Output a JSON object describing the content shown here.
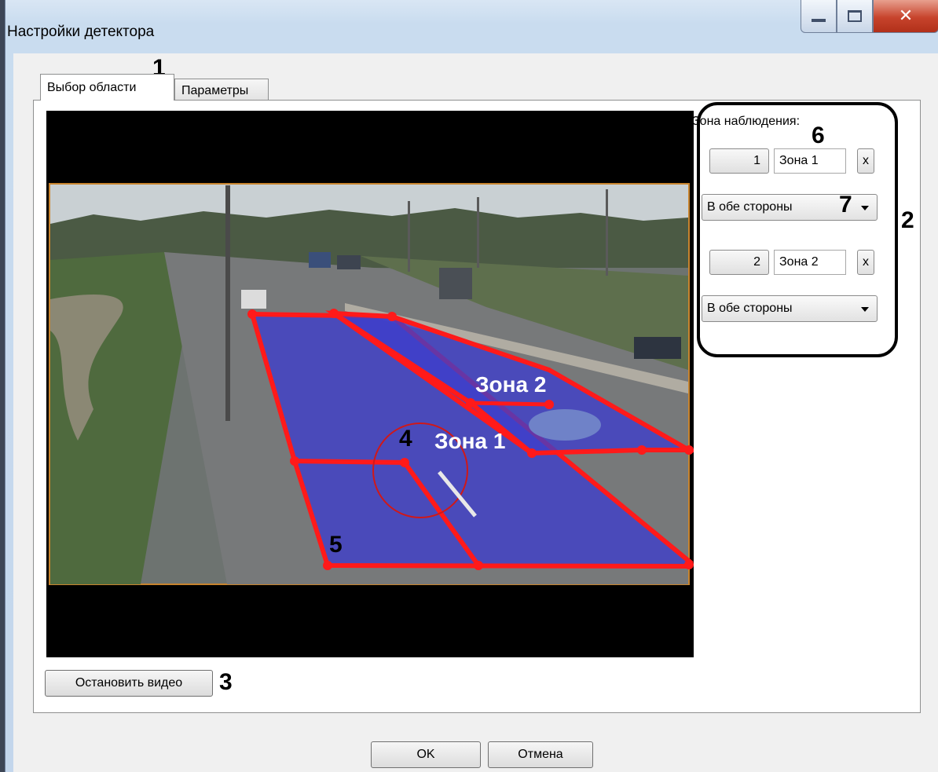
{
  "window": {
    "title": "Настройки детектора"
  },
  "tabs": [
    {
      "label": "Выбор области",
      "active": true
    },
    {
      "label": "Параметры",
      "active": false
    }
  ],
  "callouts": {
    "c1": "1",
    "c2": "2",
    "c3": "3",
    "c4": "4",
    "c5": "5",
    "c6": "6",
    "c7": "7"
  },
  "video": {
    "zone1_label": "Зона 1",
    "zone2_label": "Зона 2"
  },
  "zones_panel": {
    "title": "Зона наблюдения:",
    "zones": [
      {
        "number": "1",
        "name": "Зона 1",
        "remove_label": "x",
        "direction": "В обе стороны"
      },
      {
        "number": "2",
        "name": "Зона 2",
        "remove_label": "x",
        "direction": "В обе стороны"
      }
    ]
  },
  "stop_video_label": "Остановить видео",
  "ok_label": "OK",
  "cancel_label": "Отмена",
  "colors": {
    "zone_fill": "#3d3dcc",
    "zone_border": "#ff1a1a",
    "close_button": "#c7432c"
  }
}
